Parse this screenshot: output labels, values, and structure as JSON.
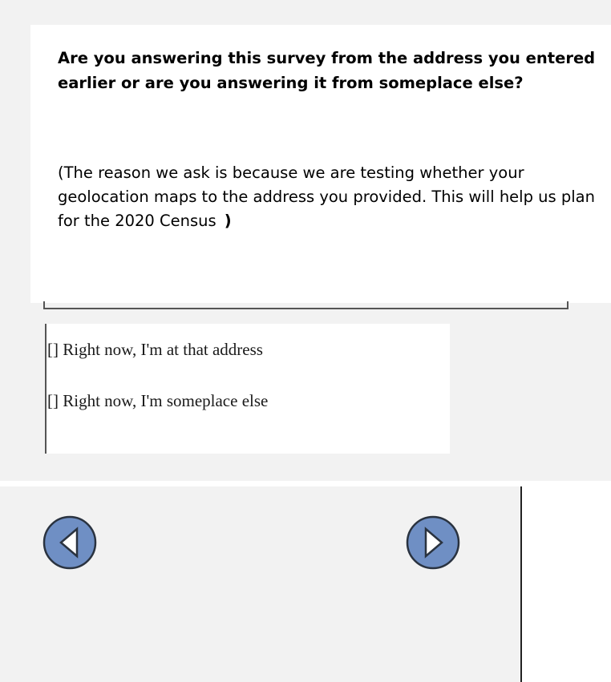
{
  "question": {
    "text": "Are you answering this survey from the address you entered earlier or are you answering it from someplace else?",
    "explanation": "(The reason we ask is because we are testing whether your geolocation maps to the address you provided. This will help us plan for the 2020 Census",
    "explanation_close": ")"
  },
  "options": [
    {
      "label": "[] Right now, I'm at that address"
    },
    {
      "label": "[] Right now, I'm someplace else"
    }
  ],
  "navigation": {
    "back_icon": "left-triangle-icon",
    "next_icon": "right-triangle-icon"
  },
  "colors": {
    "background_gray": "#f2f2f2",
    "button_fill": "#6f8fc4",
    "button_outline": "#2a3340"
  }
}
